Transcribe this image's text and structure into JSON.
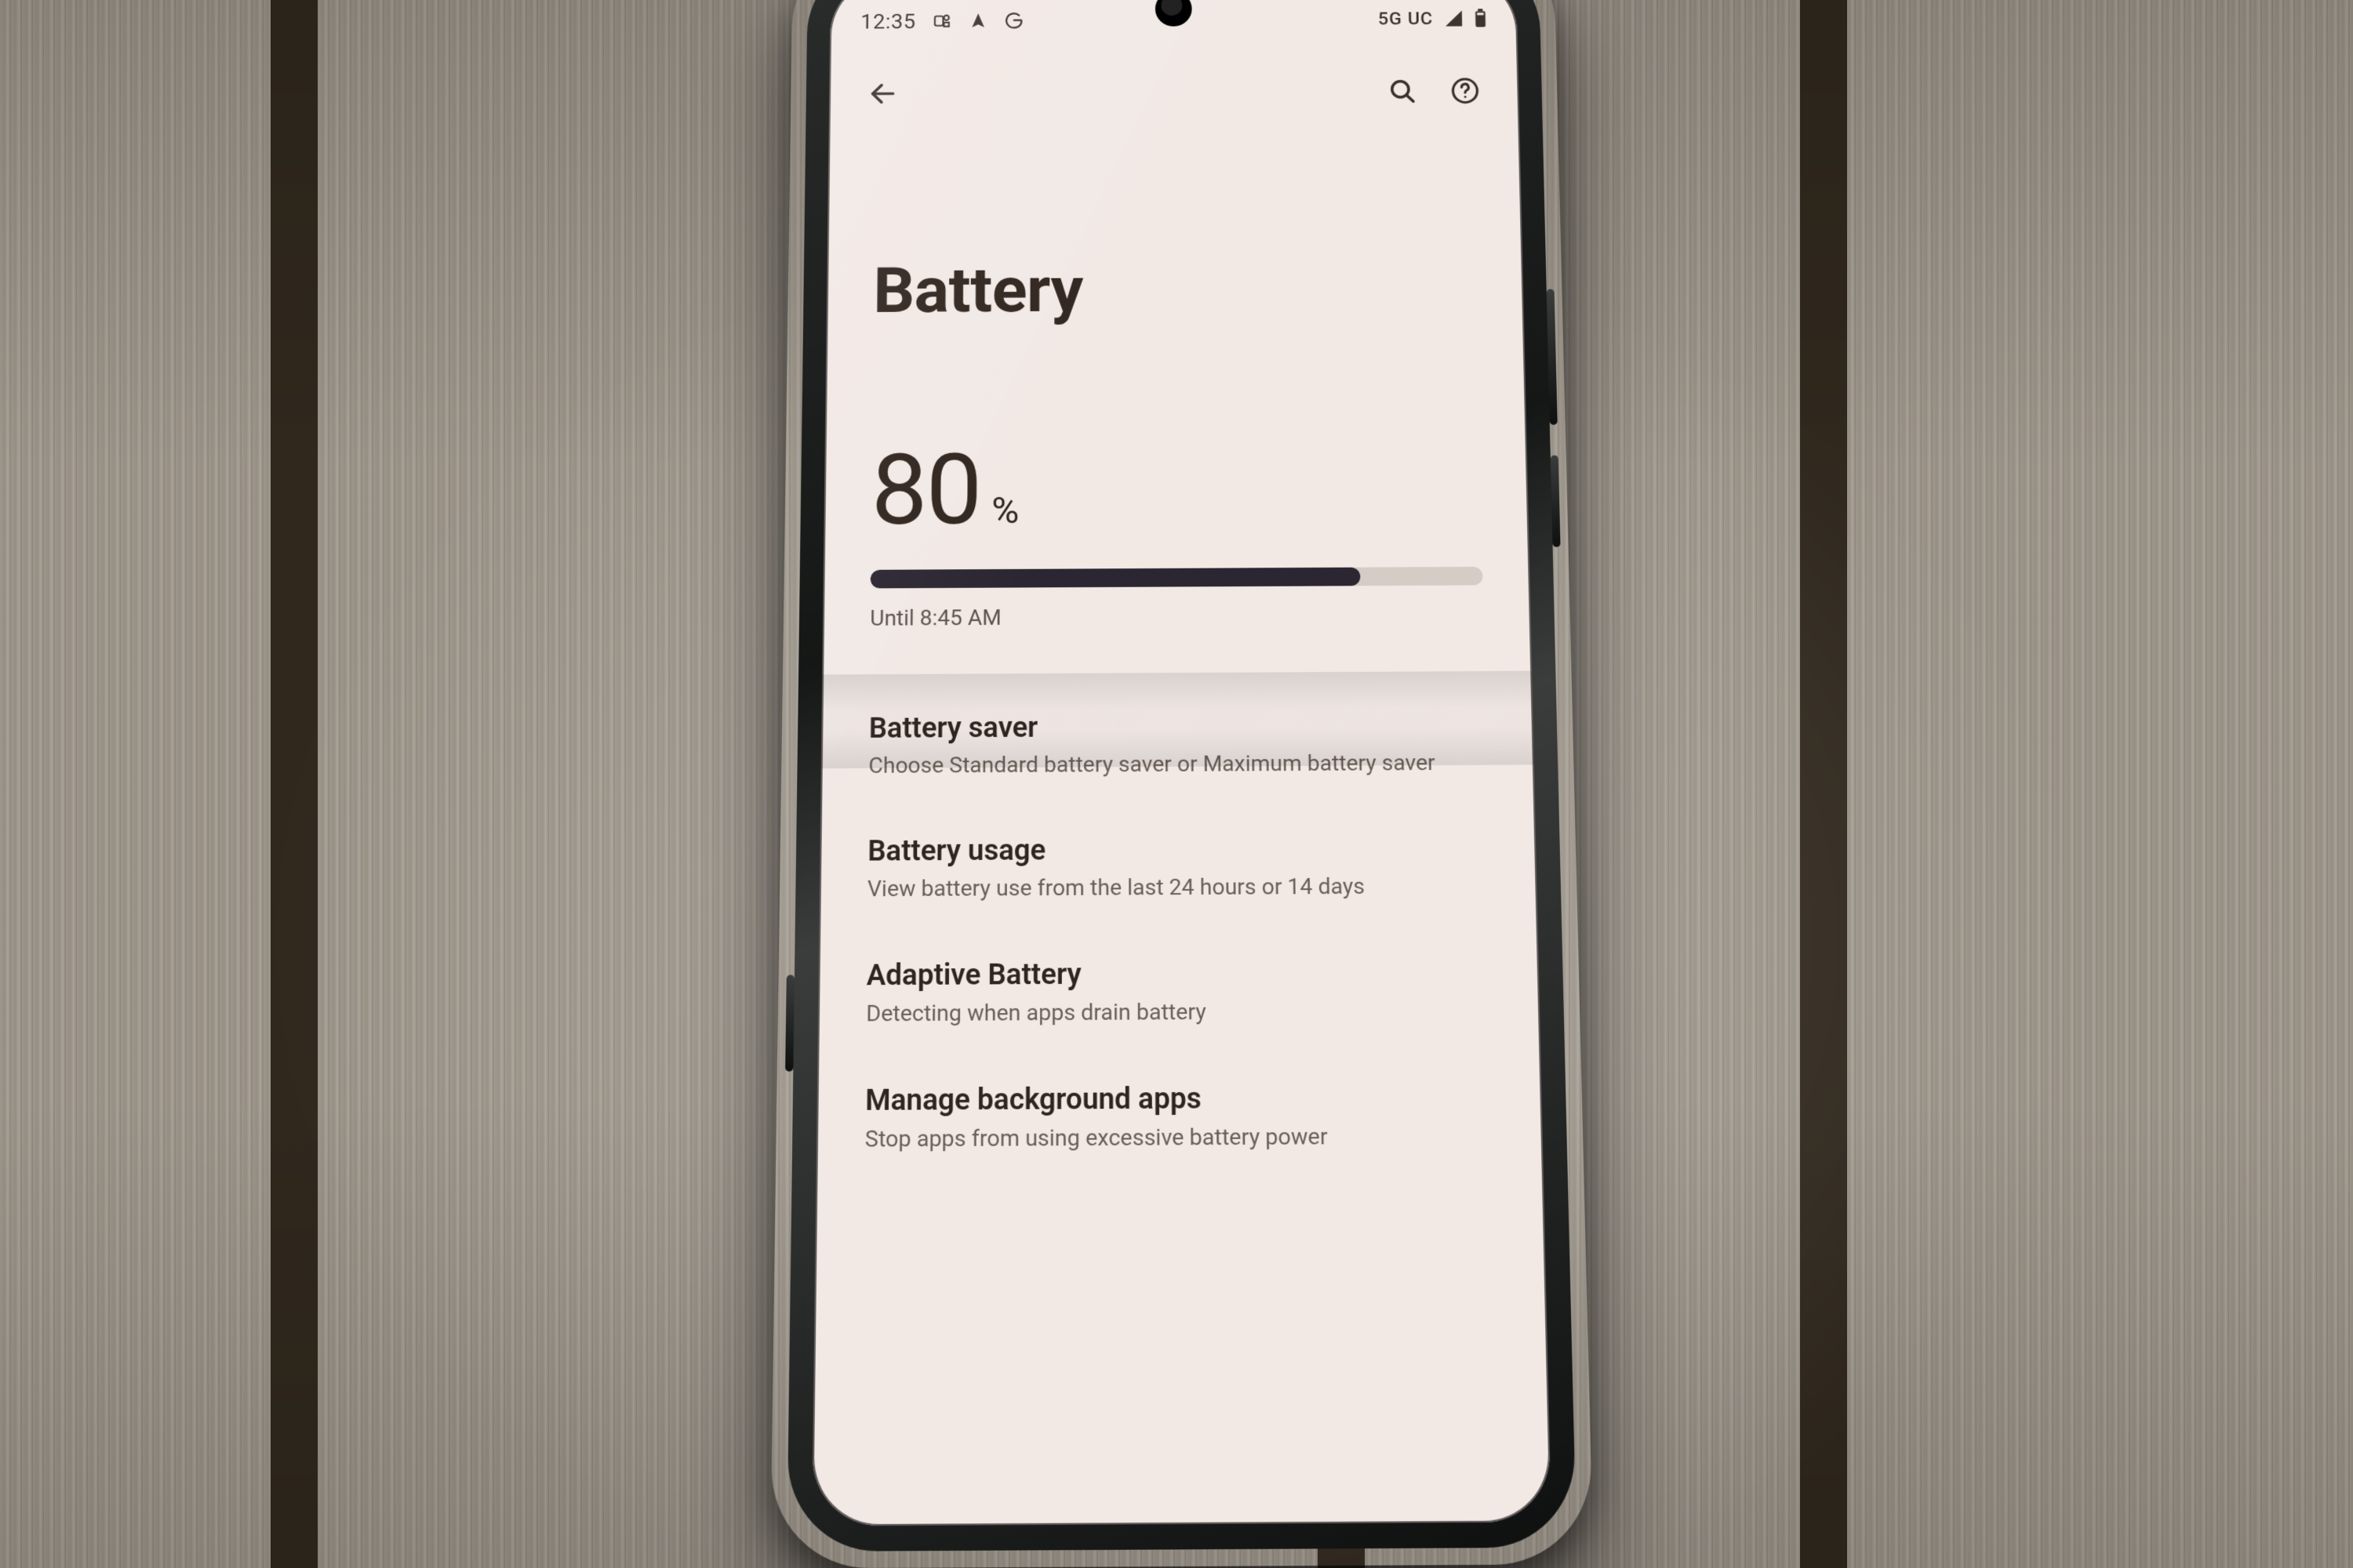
{
  "statusbar": {
    "time": "12:35",
    "net_label": "5G UC"
  },
  "actions": {
    "back": "Back",
    "search": "Search",
    "help": "Help"
  },
  "page": {
    "title": "Battery"
  },
  "battery": {
    "percent_value": "80",
    "percent_symbol": "%",
    "percent_num": 80,
    "estimate": "Until 8:45 AM"
  },
  "list": [
    {
      "title": "Battery saver",
      "sub": "Choose Standard battery saver or Maximum battery saver"
    },
    {
      "title": "Battery usage",
      "sub": "View battery use from the last 24 hours or 14 days"
    },
    {
      "title": "Adaptive Battery",
      "sub": "Detecting when apps drain battery"
    },
    {
      "title": "Manage background apps",
      "sub": "Stop apps from using excessive battery power"
    }
  ]
}
